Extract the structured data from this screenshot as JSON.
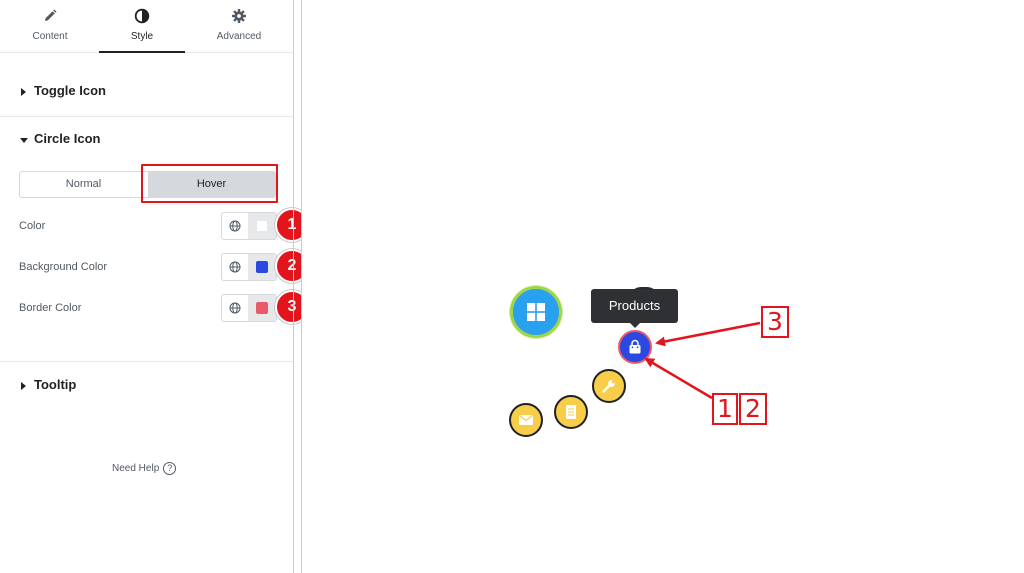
{
  "tabs": [
    {
      "label": "Content",
      "icon": "pencil-icon"
    },
    {
      "label": "Style",
      "icon": "contrast-icon"
    },
    {
      "label": "Advanced",
      "icon": "gear-icon"
    }
  ],
  "active_tab": "Style",
  "sections": {
    "toggle_icon": "Toggle Icon",
    "circle_icon": "Circle Icon",
    "tooltip": "Tooltip"
  },
  "state_switch": {
    "normal": "Normal",
    "hover": "Hover",
    "selected": "Hover"
  },
  "controls": [
    {
      "label": "Color",
      "swatch": "#ffffff",
      "badge": "1"
    },
    {
      "label": "Background Color",
      "swatch": "#2b48e0",
      "badge": "2"
    },
    {
      "label": "Border Color",
      "swatch": "#ea5a6a",
      "badge": "3"
    }
  ],
  "need_help": "Need Help",
  "need_help_icon": "?",
  "canvas": {
    "tooltip_text": "Products",
    "callout_top": "3",
    "callout_bottom_a": "1",
    "callout_bottom_b": "2",
    "icons": [
      "windows-icon",
      "shopping-bag-icon",
      "wrench-icon",
      "document-icon",
      "envelope-icon"
    ]
  },
  "colors": {
    "accent_red": "#e2141c",
    "main_circle": "#2aa1ee",
    "small_circle": "#f7cd49",
    "hover_bg": "#2b48e0",
    "hover_border": "#ea5a6a"
  }
}
